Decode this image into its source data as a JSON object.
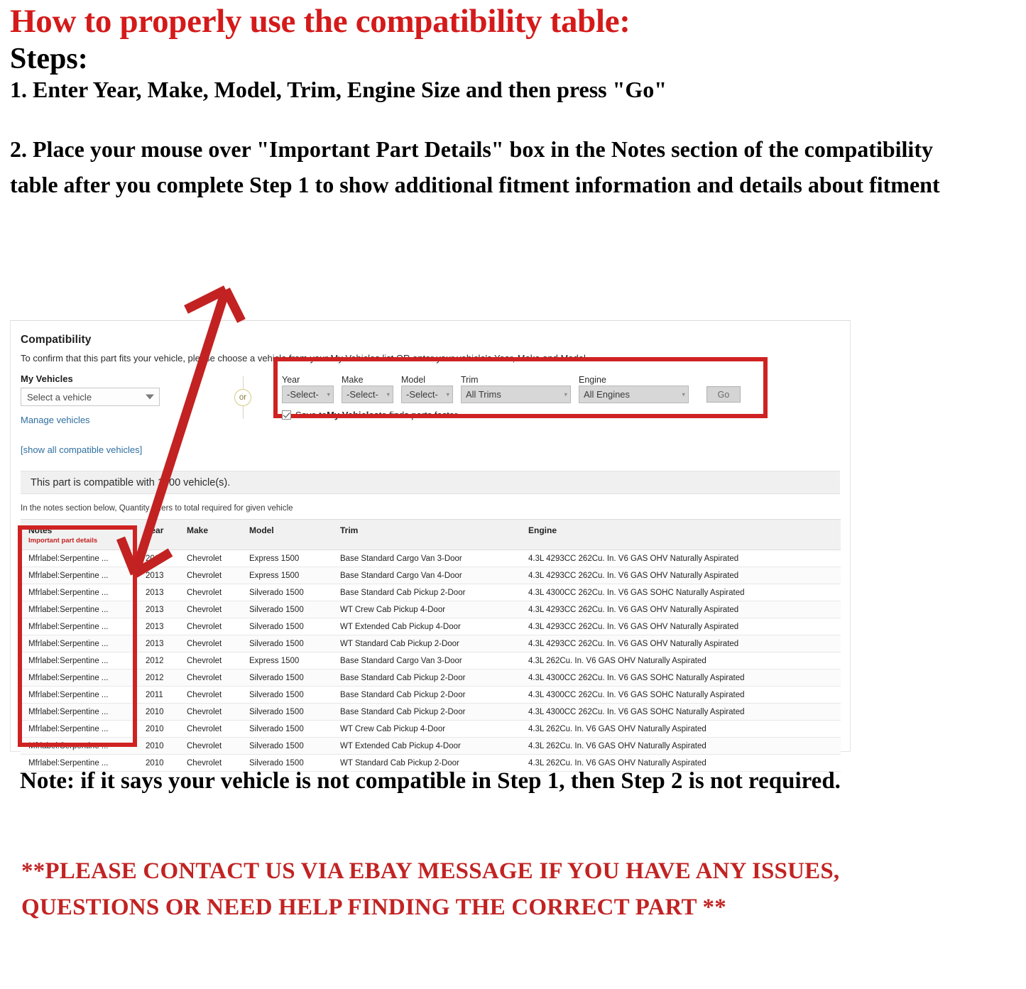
{
  "instructions": {
    "heading": "How to properly use the compatibility table:",
    "steps_label": "Steps:",
    "step1": "1. Enter Year, Make, Model, Trim, Engine Size and then press \"Go\"",
    "step2": "2. Place your mouse over \"Important Part Details\" box in the Notes section of the compatibility table after you complete Step 1 to show additional fitment information and details about fitment",
    "note": "Note: if it says your vehicle is not compatible in Step 1, then Step 2 is not required.",
    "contact": "**PLEASE CONTACT US VIA EBAY MESSAGE IF YOU HAVE ANY ISSUES, QUESTIONS OR NEED HELP FINDING THE CORRECT PART **"
  },
  "panel": {
    "title": "Compatibility",
    "subtitle": "To confirm that this part fits your vehicle, please choose a vehicle from your My Vehicles list OR enter your vehicle's Year, Make and Model.",
    "my_vehicles_label": "My Vehicles",
    "vehicle_select_value": "Select a vehicle",
    "manage_vehicles_link": "Manage vehicles",
    "show_all_link": "[show all compatible vehicles]",
    "or_text": "or",
    "compatible_banner": "This part is compatible with 1000 vehicle(s).",
    "quantity_note": "In the notes section below, Quantity refers to total required for given vehicle"
  },
  "form": {
    "fields": [
      {
        "label": "Year",
        "value": "-Select-"
      },
      {
        "label": "Make",
        "value": "-Select-"
      },
      {
        "label": "Model",
        "value": "-Select-"
      },
      {
        "label": "Trim",
        "value": "All Trims"
      },
      {
        "label": "Engine",
        "value": "All Engines"
      }
    ],
    "go_label": "Go",
    "save_prefix": "Save to ",
    "save_bold": "My Vehicles",
    "save_suffix": " to finds parts faster",
    "save_checked": true
  },
  "table": {
    "headers": {
      "notes": "Notes",
      "notes_sub": "Important part details",
      "year": "Year",
      "make": "Make",
      "model": "Model",
      "trim": "Trim",
      "engine": "Engine"
    },
    "rows": [
      {
        "notes": "Mfrlabel:Serpentine ...",
        "year": "2013",
        "make": "Chevrolet",
        "model": "Express 1500",
        "trim": "Base Standard Cargo Van 3-Door",
        "engine": "4.3L 4293CC 262Cu. In. V6 GAS OHV Naturally Aspirated"
      },
      {
        "notes": "Mfrlabel:Serpentine ...",
        "year": "2013",
        "make": "Chevrolet",
        "model": "Express 1500",
        "trim": "Base Standard Cargo Van 4-Door",
        "engine": "4.3L 4293CC 262Cu. In. V6 GAS OHV Naturally Aspirated"
      },
      {
        "notes": "Mfrlabel:Serpentine ...",
        "year": "2013",
        "make": "Chevrolet",
        "model": "Silverado 1500",
        "trim": "Base Standard Cab Pickup 2-Door",
        "engine": "4.3L 4300CC 262Cu. In. V6 GAS SOHC Naturally Aspirated"
      },
      {
        "notes": "Mfrlabel:Serpentine ...",
        "year": "2013",
        "make": "Chevrolet",
        "model": "Silverado 1500",
        "trim": "WT Crew Cab Pickup 4-Door",
        "engine": "4.3L 4293CC 262Cu. In. V6 GAS OHV Naturally Aspirated"
      },
      {
        "notes": "Mfrlabel:Serpentine ...",
        "year": "2013",
        "make": "Chevrolet",
        "model": "Silverado 1500",
        "trim": "WT Extended Cab Pickup 4-Door",
        "engine": "4.3L 4293CC 262Cu. In. V6 GAS OHV Naturally Aspirated"
      },
      {
        "notes": "Mfrlabel:Serpentine ...",
        "year": "2013",
        "make": "Chevrolet",
        "model": "Silverado 1500",
        "trim": "WT Standard Cab Pickup 2-Door",
        "engine": "4.3L 4293CC 262Cu. In. V6 GAS OHV Naturally Aspirated"
      },
      {
        "notes": "Mfrlabel:Serpentine ...",
        "year": "2012",
        "make": "Chevrolet",
        "model": "Express 1500",
        "trim": "Base Standard Cargo Van 3-Door",
        "engine": "4.3L 262Cu. In. V6 GAS OHV Naturally Aspirated"
      },
      {
        "notes": "Mfrlabel:Serpentine ...",
        "year": "2012",
        "make": "Chevrolet",
        "model": "Silverado 1500",
        "trim": "Base Standard Cab Pickup 2-Door",
        "engine": "4.3L 4300CC 262Cu. In. V6 GAS SOHC Naturally Aspirated"
      },
      {
        "notes": "Mfrlabel:Serpentine ...",
        "year": "2011",
        "make": "Chevrolet",
        "model": "Silverado 1500",
        "trim": "Base Standard Cab Pickup 2-Door",
        "engine": "4.3L 4300CC 262Cu. In. V6 GAS SOHC Naturally Aspirated"
      },
      {
        "notes": "Mfrlabel:Serpentine ...",
        "year": "2010",
        "make": "Chevrolet",
        "model": "Silverado 1500",
        "trim": "Base Standard Cab Pickup 2-Door",
        "engine": "4.3L 4300CC 262Cu. In. V6 GAS SOHC Naturally Aspirated"
      },
      {
        "notes": "Mfrlabel:Serpentine ...",
        "year": "2010",
        "make": "Chevrolet",
        "model": "Silverado 1500",
        "trim": "WT Crew Cab Pickup 4-Door",
        "engine": "4.3L 262Cu. In. V6 GAS OHV Naturally Aspirated"
      },
      {
        "notes": "Mfrlabel:Serpentine ...",
        "year": "2010",
        "make": "Chevrolet",
        "model": "Silverado 1500",
        "trim": "WT Extended Cab Pickup 4-Door",
        "engine": "4.3L 262Cu. In. V6 GAS OHV Naturally Aspirated"
      },
      {
        "notes": "Mfrlabel:Serpentine ...",
        "year": "2010",
        "make": "Chevrolet",
        "model": "Silverado 1500",
        "trim": "WT Standard Cab Pickup 2-Door",
        "engine": "4.3L 262Cu. In. V6 GAS OHV Naturally Aspirated"
      }
    ]
  },
  "colors": {
    "heading_red": "#d41a1a",
    "annotation_red": "#cf2222",
    "link_blue": "#2f6f9f",
    "important_red": "#c42121"
  }
}
